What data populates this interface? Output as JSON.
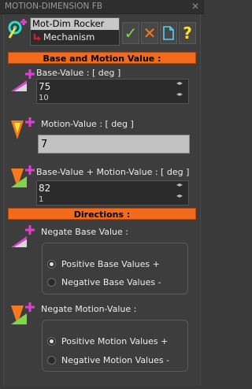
{
  "window": {
    "title": "MOTION-DIMENSION FB",
    "close_glyph": "✕"
  },
  "tree": {
    "item1": "Mot-Dim Rocker",
    "item2": "Mechanism"
  },
  "toolbar": {
    "ok_glyph": "✓",
    "cancel_glyph": "✕",
    "help_glyph": "?"
  },
  "sections": {
    "base_and_motion": "Base and Motion Value :",
    "directions": "Directions :"
  },
  "base_value": {
    "label": "Base-Value : [ deg ]",
    "value": "75",
    "step": "10"
  },
  "motion_value": {
    "label": "Motion-Value : [ deg ]",
    "value": "7"
  },
  "total_value": {
    "label": "Base-Value + Motion-Value : [ deg ]",
    "value": "82",
    "step": "1"
  },
  "negate_base": {
    "label": "Negate Base Value :",
    "options": [
      "Positive Base Values +",
      "Negative Base Values -"
    ],
    "selected": 0
  },
  "negate_motion": {
    "label": "Negate Motion-Value :",
    "options": [
      "Positive Motion Values +",
      "Negative Motion Values -"
    ],
    "selected": 0
  },
  "colors": {
    "section_bar": "#f26b1d",
    "accent_magenta": "#e040d0",
    "accent_orange": "#f47a20",
    "ok_green": "#7fd64a",
    "help_yellow": "#ffe02a"
  }
}
